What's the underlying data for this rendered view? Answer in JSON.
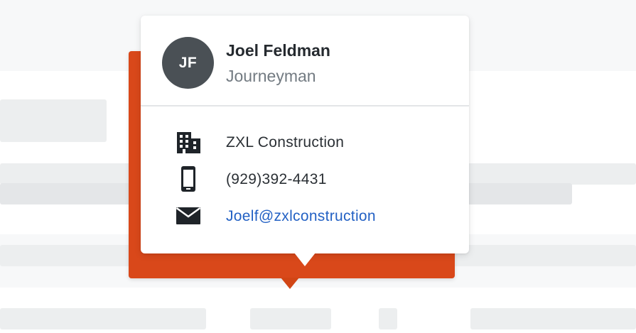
{
  "contact_card": {
    "initials": "JF",
    "name": "Joel Feldman",
    "role": "Journeyman",
    "company": "ZXL Construction",
    "phone": "(929)392-4431",
    "email": "Joelf@zxlconstruction"
  },
  "icons": {
    "company": "building-icon",
    "phone": "mobile-phone-icon",
    "email": "envelope-icon"
  },
  "colors": {
    "accent_orange": "#d9481a",
    "avatar_bg": "#4a5055",
    "link_blue": "#2361c4"
  }
}
